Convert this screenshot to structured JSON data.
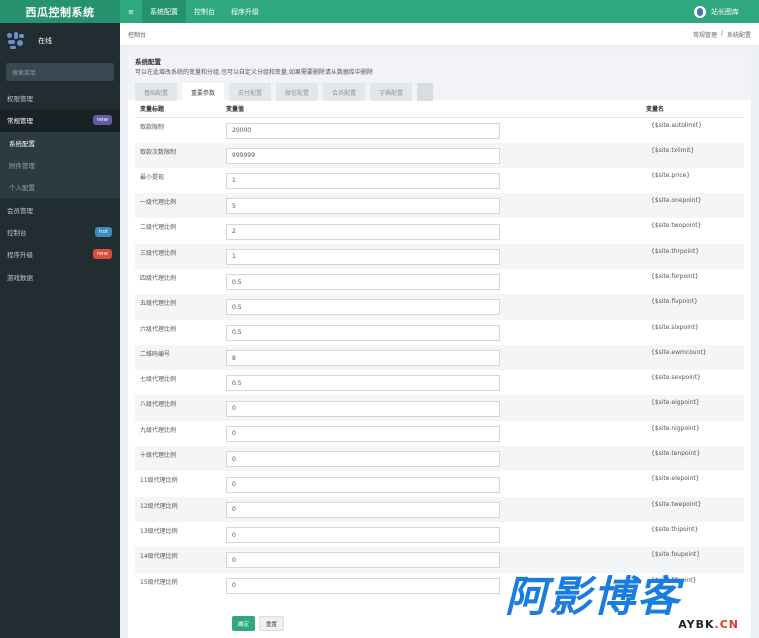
{
  "app": {
    "title": "西瓜控制系统"
  },
  "topnav": {
    "toggle": "≡",
    "items": [
      "系统配置",
      "控制台",
      "程序升级"
    ],
    "user": "站长图库"
  },
  "sidebar": {
    "status": "在线",
    "search_placeholder": "搜索菜单",
    "items": [
      {
        "label": "权限管理",
        "badge": "",
        "badge_color": ""
      },
      {
        "label": "常规管理",
        "badge": "new",
        "badge_color": "#605ca8"
      },
      {
        "label": "系统配置",
        "badge": "",
        "badge_color": ""
      },
      {
        "label": "附件管理",
        "badge": "",
        "badge_color": ""
      },
      {
        "label": "个人配置",
        "badge": "",
        "badge_color": ""
      },
      {
        "label": "会员管理",
        "badge": "",
        "badge_color": ""
      },
      {
        "label": "控制台",
        "badge": "hot",
        "badge_color": "#3c8dbc"
      },
      {
        "label": "程序升级",
        "badge": "new",
        "badge_color": "#dd4b39"
      },
      {
        "label": "游戏数据",
        "badge": "",
        "badge_color": ""
      }
    ]
  },
  "breadcrumb_bar": {
    "title": "控制台",
    "crumbs": [
      "常规管理",
      "/",
      "系统配置"
    ]
  },
  "box": {
    "title": "系统配置",
    "description": "可以在此增改系统的变量和分组,也可以自定义分组和变量,如果需要删除请从数据库中删除",
    "tabs": [
      "基础配置",
      "重要参数",
      "支付配置",
      "微信配置",
      "会员配置",
      "字典配置"
    ],
    "active_tab": 1
  },
  "table": {
    "headers": [
      "变量标题",
      "变量值",
      "变量名"
    ],
    "rows": [
      {
        "title": "取款限制",
        "value": "20000",
        "name": "{$site.autolimit}"
      },
      {
        "title": "取款次数限制",
        "value": "999999",
        "name": "{$site.txlimit}"
      },
      {
        "title": "最小提现",
        "value": "1",
        "name": "{$site.price}"
      },
      {
        "title": "一级代理比例",
        "value": "5",
        "name": "{$site.onepoint}"
      },
      {
        "title": "二级代理比例",
        "value": "2",
        "name": "{$site.twopoint}"
      },
      {
        "title": "三级代理比例",
        "value": "1",
        "name": "{$site.thrpoint}"
      },
      {
        "title": "四级代理比例",
        "value": "0.5",
        "name": "{$site.forpoint}"
      },
      {
        "title": "五级代理比例",
        "value": "0.5",
        "name": "{$site.fivpoint}"
      },
      {
        "title": "六级代理比例",
        "value": "0.5",
        "name": "{$site.sixpoint}"
      },
      {
        "title": "二维码编号",
        "value": "8",
        "name": "{$site.ewmcount}"
      },
      {
        "title": "七级代理比例",
        "value": "0.5",
        "name": "{$site.sevpoint}"
      },
      {
        "title": "八级代理比例",
        "value": "0",
        "name": "{$site.eigpoint}"
      },
      {
        "title": "九级代理比例",
        "value": "0",
        "name": "{$site.nigpoint}"
      },
      {
        "title": "十级代理比例",
        "value": "0",
        "name": "{$site.tenpoint}"
      },
      {
        "title": "11级代理比例",
        "value": "0",
        "name": "{$site.elepoint}"
      },
      {
        "title": "12级代理比例",
        "value": "0",
        "name": "{$site.twepoint}"
      },
      {
        "title": "13级代理比例",
        "value": "0",
        "name": "{$site.thipoint}"
      },
      {
        "title": "14级代理比例",
        "value": "0",
        "name": "{$site.foupoint}"
      },
      {
        "title": "15级代理比例",
        "value": "0",
        "name": "{$site.fifpoint}"
      }
    ]
  },
  "actions": {
    "confirm": "确定",
    "reset": "重置"
  },
  "watermark": {
    "title": "阿影博客",
    "sub_main": "AYBK",
    "sub_suffix": ".CN"
  },
  "colors": {
    "brand": "#2fa87e",
    "sidebar_bg": "#222d32",
    "watermark_blue": "#1a7be0",
    "watermark_red": "#e0392b"
  }
}
